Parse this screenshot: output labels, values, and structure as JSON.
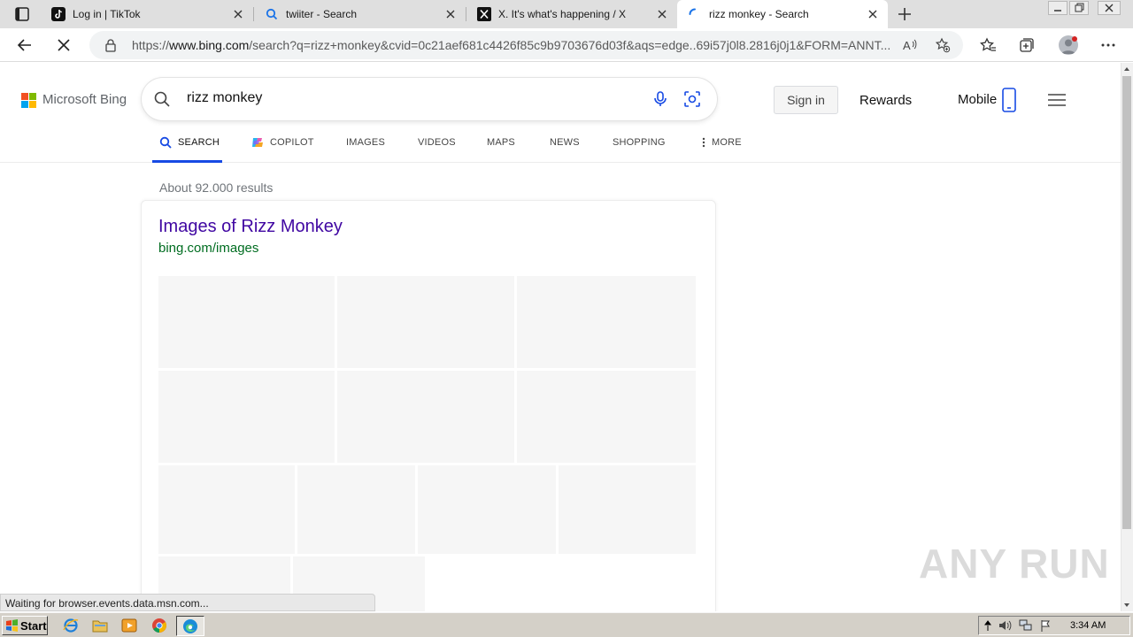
{
  "browser": {
    "tabs": [
      {
        "title": "Log in | TikTok",
        "favicon": "tiktok-icon",
        "active": false
      },
      {
        "title": "twiiter - Search",
        "favicon": "search-icon",
        "active": false
      },
      {
        "title": "X. It's what's happening / X",
        "favicon": "x-icon",
        "active": false
      },
      {
        "title": "rizz monkey - Search",
        "favicon": "loading-icon",
        "active": true
      }
    ],
    "address_bar": {
      "prefix": "https://",
      "domain": "www.bing.com",
      "path": "/search?q=rizz+monkey&cvid=0c21aef681c4426f85c9b9703676d03f&aqs=edge..69i57j0l8.2816j0j1&FORM=ANNT..."
    },
    "status_text": "Waiting for browser.events.data.msn.com..."
  },
  "bing": {
    "brand": "Microsoft Bing",
    "logo_colors": [
      "#f25022",
      "#7fba00",
      "#00a4ef",
      "#ffb900"
    ],
    "query": "rizz monkey",
    "signin_label": "Sign in",
    "rewards_label": "Rewards",
    "mobile_label": "Mobile",
    "scopes": [
      {
        "label": "SEARCH",
        "icon": "search-icon",
        "active": true
      },
      {
        "label": "COPILOT",
        "icon": "copilot-icon",
        "active": false
      },
      {
        "label": "IMAGES",
        "active": false
      },
      {
        "label": "VIDEOS",
        "active": false
      },
      {
        "label": "MAPS",
        "active": false
      },
      {
        "label": "NEWS",
        "active": false
      },
      {
        "label": "SHOPPING",
        "active": false
      },
      {
        "label": "MORE",
        "icon": "more-dots-icon",
        "active": false
      }
    ],
    "result_count": "About 92.000 results",
    "images_card": {
      "title": "Images of Rizz Monkey",
      "url": "bing.com/images"
    }
  },
  "watermark": "ANY RUN",
  "taskbar": {
    "start_label": "Start",
    "clock": "3:34 AM"
  }
}
